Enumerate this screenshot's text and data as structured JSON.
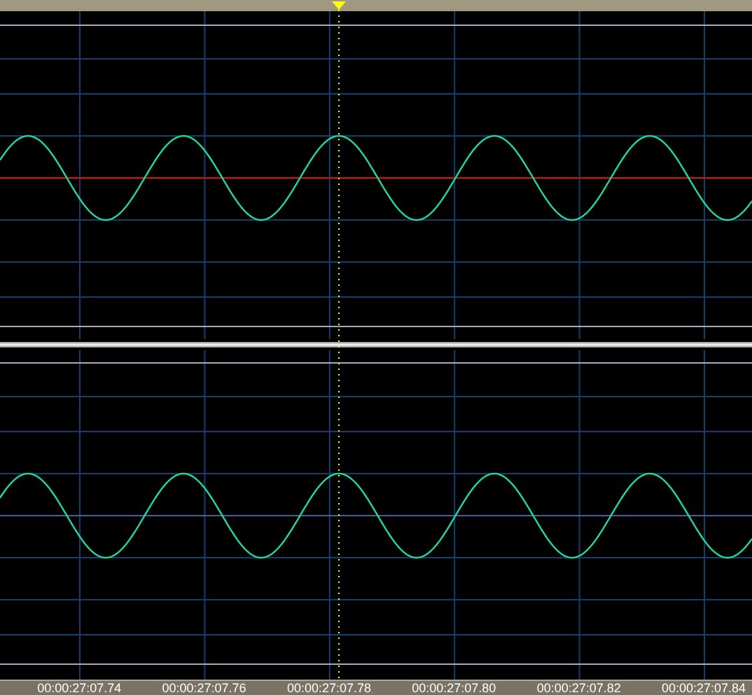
{
  "time_ruler": {
    "labels": [
      "00:00:27:07.74",
      "00:00:27:07.76",
      "00:00:27:07.78",
      "00:00:27:07.80",
      "00:00:27:07.82",
      "00:00:27:07.84"
    ]
  }
}
